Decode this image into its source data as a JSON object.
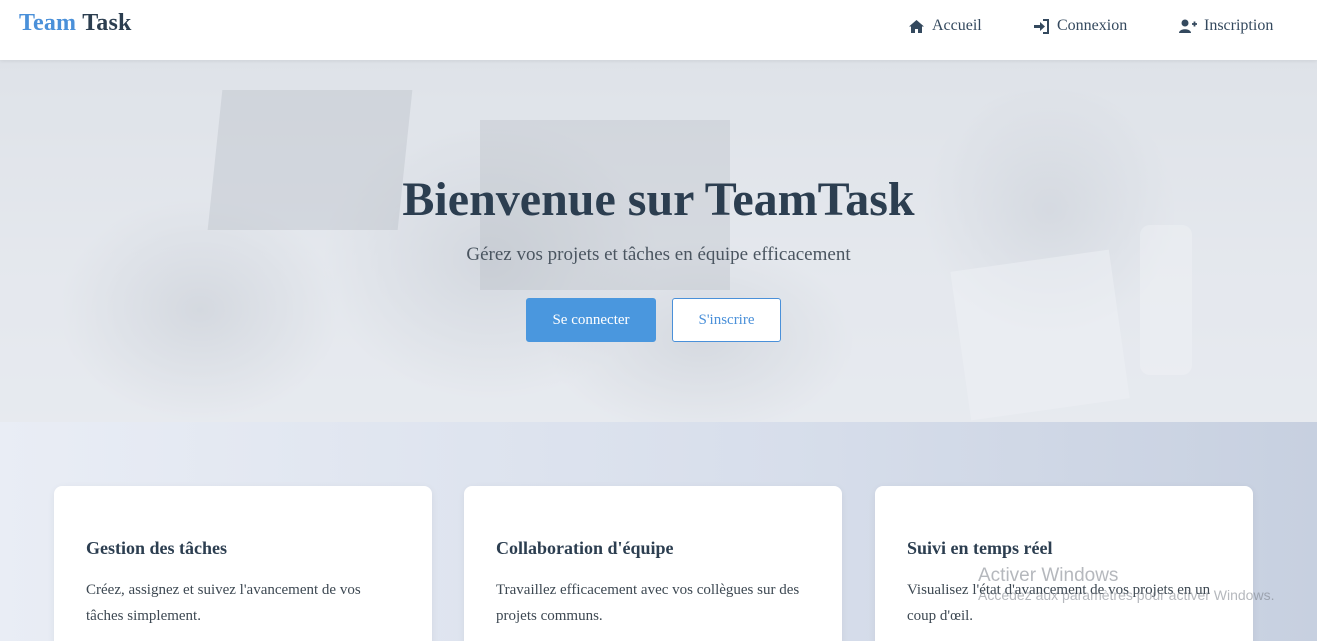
{
  "header": {
    "brand_part1": "Team",
    "brand_part2": "Task",
    "nav": [
      {
        "label": "Accueil",
        "icon": "home-icon"
      },
      {
        "label": "Connexion",
        "icon": "sign-in-icon"
      },
      {
        "label": "Inscription",
        "icon": "user-plus-icon"
      }
    ]
  },
  "hero": {
    "title": "Bienvenue sur TeamTask",
    "subtitle": "Gérez vos projets et tâches en équipe efficacement",
    "primary_button": "Se connecter",
    "secondary_button": "S'inscrire"
  },
  "features": [
    {
      "title": "Gestion des tâches",
      "text": "Créez, assignez et suivez l'avancement de vos tâches simplement."
    },
    {
      "title": "Collaboration d'équipe",
      "text": "Travaillez efficacement avec vos collègues sur des projets communs."
    },
    {
      "title": "Suivi en temps réel",
      "text": "Visualisez l'état d'avancement de vos projets en un coup d'œil."
    }
  ],
  "watermark": {
    "line1": "Activer Windows",
    "line2": "Accédez aux paramètres pour activer Windows."
  },
  "colors": {
    "accent": "#4a90d9",
    "primary_button": "#4a97de",
    "heading": "#2c3e50"
  }
}
